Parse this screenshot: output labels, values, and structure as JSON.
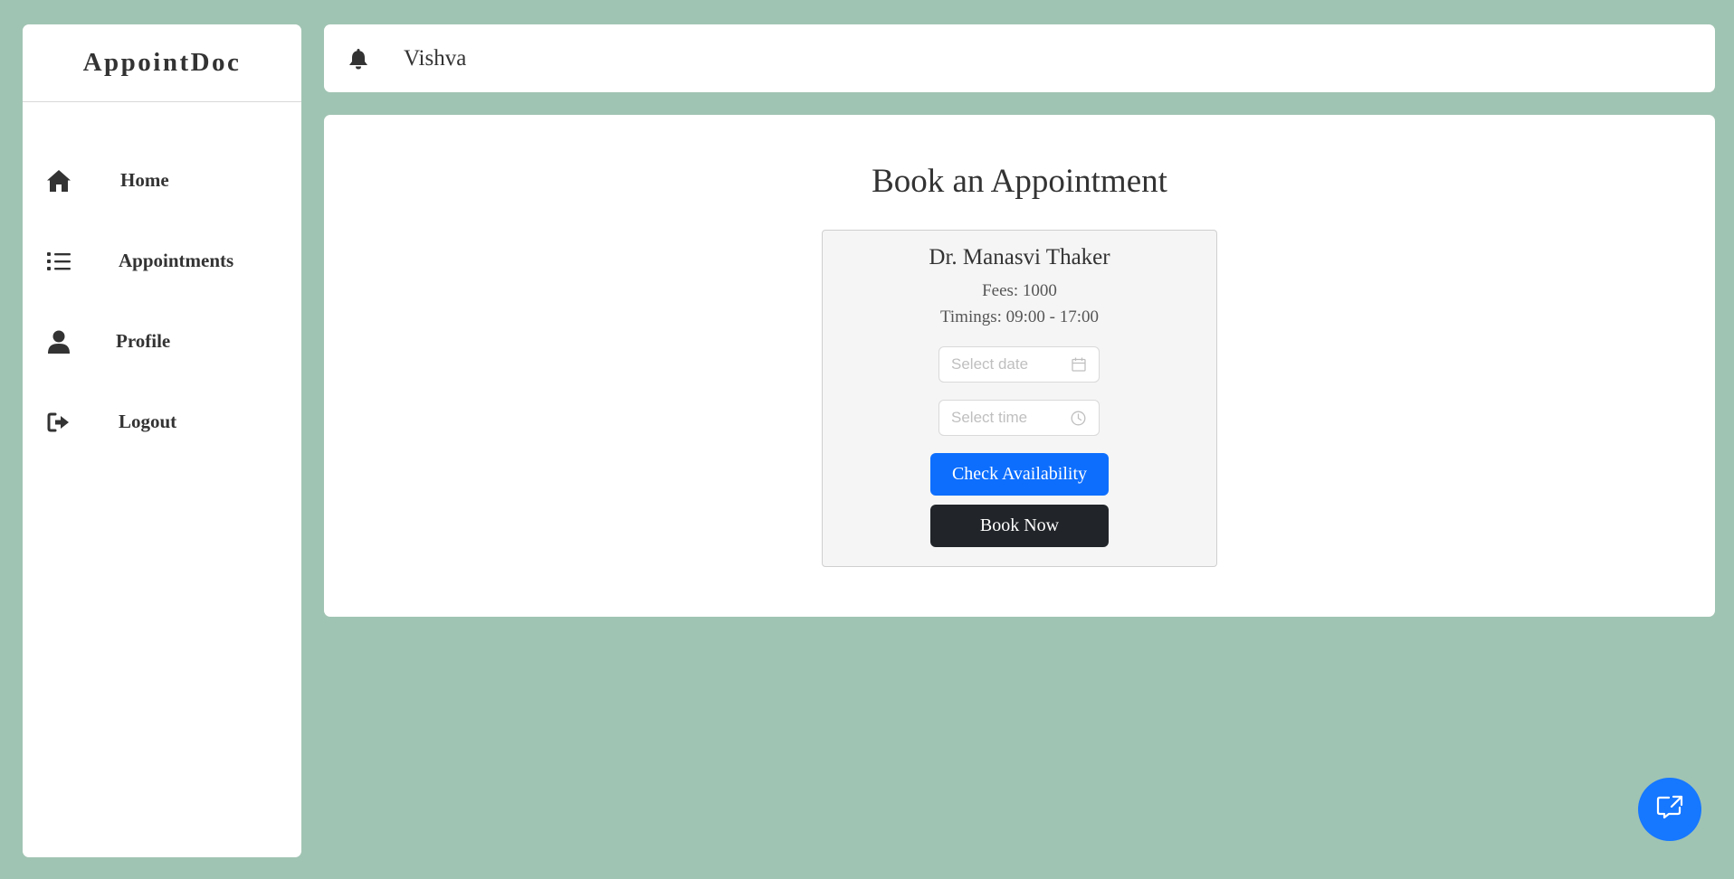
{
  "app": {
    "brand": "AppointDoc"
  },
  "sidebar": {
    "items": [
      {
        "label": "Home",
        "icon": "home-icon"
      },
      {
        "label": "Appointments",
        "icon": "list-icon"
      },
      {
        "label": "Profile",
        "icon": "user-icon"
      },
      {
        "label": "Logout",
        "icon": "logout-icon"
      }
    ]
  },
  "header": {
    "username": "Vishva",
    "notification_icon": "bell-icon"
  },
  "main": {
    "title": "Book an Appointment",
    "doctor": {
      "name": "Dr. Manasvi Thaker",
      "fees": "Fees: 1000",
      "timings": "Timings: 09:00 - 17:00"
    },
    "date_picker": {
      "placeholder": "Select date",
      "icon": "calendar-icon"
    },
    "time_picker": {
      "placeholder": "Select time",
      "icon": "clock-icon"
    },
    "check_button": "Check Availability",
    "book_button": "Book Now"
  },
  "chat_button": {
    "icon": "chat-icon"
  },
  "colors": {
    "background": "#a0c4b3",
    "primary": "#0d6efd",
    "dark": "#212529",
    "fab": "#1677ff"
  }
}
